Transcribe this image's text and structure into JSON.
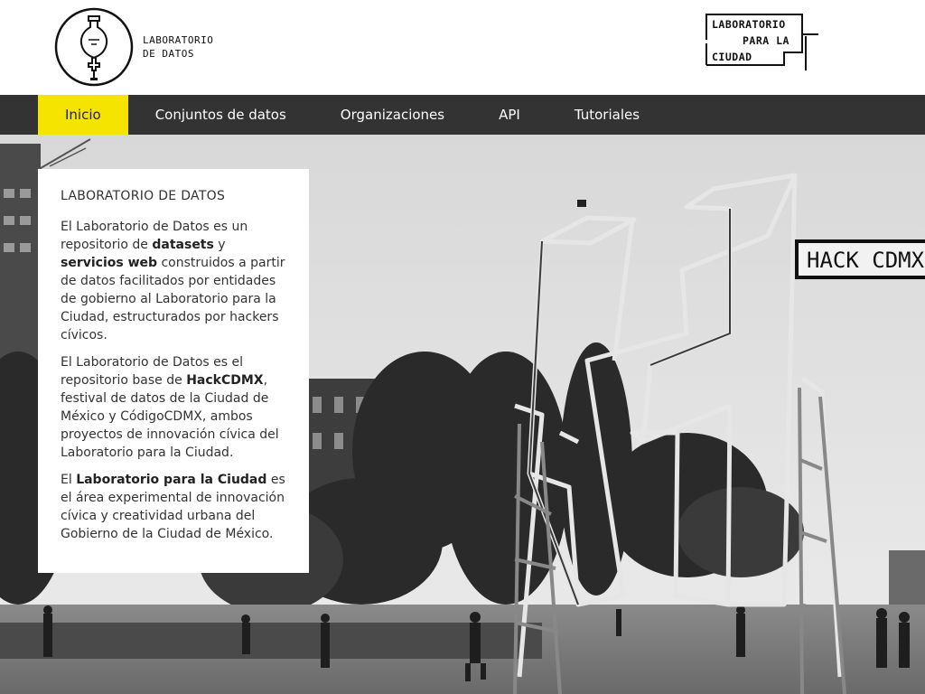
{
  "header": {
    "left_logo": {
      "line1": "LABORATORIO",
      "line2": "DE DATOS"
    },
    "right_logo": {
      "line1": "LABORATORIO",
      "line2": "PARA LA",
      "line3": "CIUDAD"
    }
  },
  "nav": {
    "items": [
      {
        "label": "Inicio",
        "active": true
      },
      {
        "label": "Conjuntos de datos"
      },
      {
        "label": "Organizaciones"
      },
      {
        "label": "API"
      },
      {
        "label": "Tutoriales"
      }
    ]
  },
  "hero": {
    "sign_text": "HACK CDMX",
    "card": {
      "title": "LABORATORIO DE DATOS",
      "p1": {
        "a": "El Laboratorio de Datos es un repositorio de ",
        "b": "datasets",
        "c": " y ",
        "d": "servicios web",
        "e": " construidos a partir de datos facilitados por entidades de gobierno al Laboratorio para la Ciudad, estructurados por hackers cívicos."
      },
      "p2": {
        "a": "El Laboratorio de Datos es el repositorio base de ",
        "b": "HackCDMX",
        "c": ", festival de datos de la Ciudad de México y CódigoCDMX, ambos proyectos de innovación cívica del Laboratorio para la Ciudad."
      },
      "p3": {
        "a": "El ",
        "b": "Laboratorio para la Ciudad",
        "c": " es el área experimental de innovación cívica y creatividad urbana del Gobierno de la Ciudad de México."
      }
    }
  },
  "colors": {
    "nav_bg": "#333333",
    "nav_active": "#f5e300",
    "card_bg": "#ffffff"
  }
}
